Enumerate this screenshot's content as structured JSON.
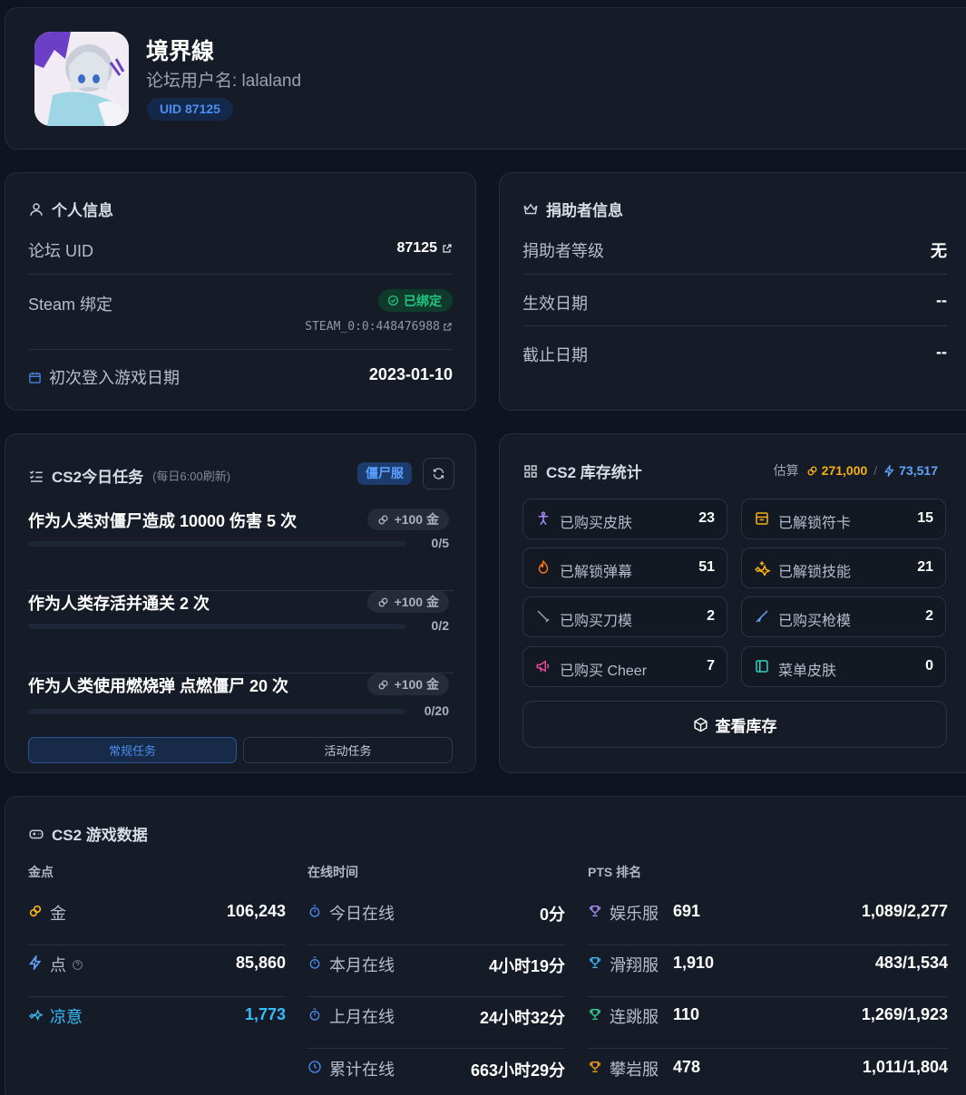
{
  "profile": {
    "name": "境界線",
    "username_label": "论坛用户名: lalaland",
    "uid_badge": "UID 87125"
  },
  "personal": {
    "title": "个人信息",
    "forum_uid_label": "论坛 UID",
    "forum_uid_value": "87125",
    "steam_label": "Steam 绑定",
    "steam_status": "已绑定",
    "steam_id": "STEAM_0:0:448476988",
    "first_login_label": "初次登入游戏日期",
    "first_login_value": "2023-01-10"
  },
  "donor": {
    "title": "捐助者信息",
    "level_label": "捐助者等级",
    "level_value": "无",
    "start_label": "生效日期",
    "start_value": "--",
    "end_label": "截止日期",
    "end_value": "--"
  },
  "tasks": {
    "title": "CS2今日任务",
    "subtitle": "(每日6:00刷新)",
    "server_badge": "僵尸服",
    "items": [
      {
        "title": "作为人类对僵尸造成 10000 伤害 5 次",
        "reward": "+100 金",
        "progress_text": "0/5",
        "progress": 0
      },
      {
        "title": "作为人类存活并通关 2 次",
        "reward": "+100 金",
        "progress_text": "0/2",
        "progress": 0
      },
      {
        "title": "作为人类使用燃烧弹 点燃僵尸 20 次",
        "reward": "+100 金",
        "progress_text": "0/20",
        "progress": 0
      }
    ],
    "tab_regular": "常规任务",
    "tab_event": "活动任务"
  },
  "inventory": {
    "title": "CS2 库存统计",
    "estimate_label": "估算",
    "gold_value": "271,000",
    "separator": "/",
    "points_value": "73,517",
    "items": [
      {
        "label": "已购买皮肤",
        "value": "23",
        "icon": "figure-icon",
        "color": "#a78bfa"
      },
      {
        "label": "已解锁符卡",
        "value": "15",
        "icon": "card-icon",
        "color": "#f5b014"
      },
      {
        "label": "已解锁弹幕",
        "value": "51",
        "icon": "flame-icon",
        "color": "#f97316"
      },
      {
        "label": "已解锁技能",
        "value": "21",
        "icon": "sparkle-icon",
        "color": "#f5b014"
      },
      {
        "label": "已购买刀模",
        "value": "2",
        "icon": "knife-icon",
        "color": "#94a3b8"
      },
      {
        "label": "已购买枪模",
        "value": "2",
        "icon": "gun-icon",
        "color": "#60a5fa"
      },
      {
        "label": "已购买 Cheer",
        "value": "7",
        "icon": "megaphone-icon",
        "color": "#ec4899"
      },
      {
        "label": "菜单皮肤",
        "value": "0",
        "icon": "panel-icon",
        "color": "#2dd4bf"
      }
    ],
    "view_button": "查看库存"
  },
  "gamedata": {
    "title": "CS2 游戏数据",
    "currency_head": "金点",
    "online_head": "在线时间",
    "rank_head": "PTS 排名",
    "currency": [
      {
        "label": "金",
        "value": "106,243",
        "color": "#f5b014"
      },
      {
        "label": "点",
        "value": "85,860",
        "color": "#60a5fa"
      },
      {
        "label": "凉意",
        "value": "1,773",
        "color": "#38bdf8"
      }
    ],
    "online": [
      {
        "label": "今日在线",
        "value": "0分"
      },
      {
        "label": "本月在线",
        "value": "4小时19分"
      },
      {
        "label": "上月在线",
        "value": "24小时32分"
      },
      {
        "label": "累计在线",
        "value": "663小时29分"
      }
    ],
    "ranks": [
      {
        "label": "娱乐服",
        "points": "691",
        "rank": "1,089/2,277",
        "color": "#a78bfa"
      },
      {
        "label": "滑翔服",
        "points": "1,910",
        "rank": "483/1,534",
        "color": "#38bdf8"
      },
      {
        "label": "连跳服",
        "points": "110",
        "rank": "1,269/1,923",
        "color": "#34d399"
      },
      {
        "label": "攀岩服",
        "points": "478",
        "rank": "1,011/1,804",
        "color": "#f59e0b"
      }
    ]
  }
}
